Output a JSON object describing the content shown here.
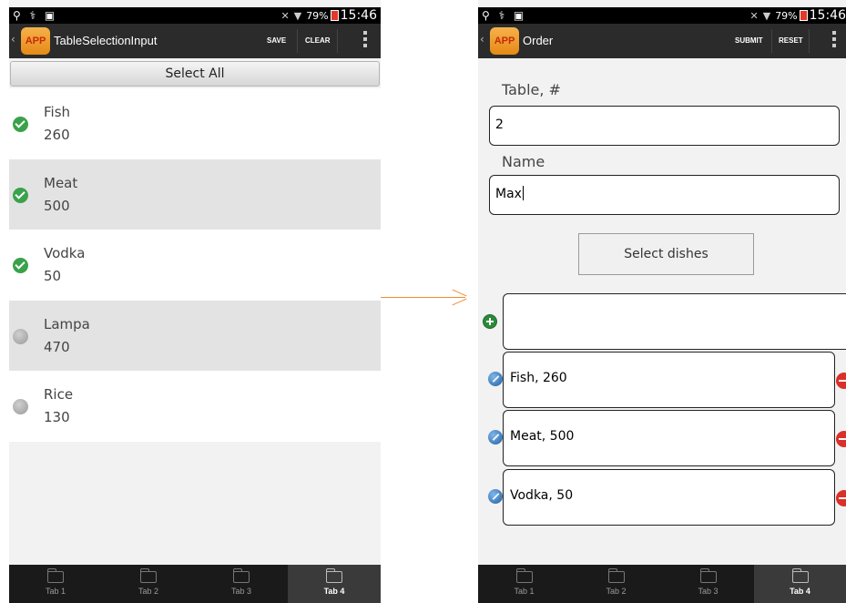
{
  "status_bar": {
    "battery": "79%",
    "time": "15:46"
  },
  "left_screen": {
    "logo_text": "APP",
    "title": "TableSelectionInput",
    "actions": {
      "save": "SAVE",
      "clear": "CLEAR"
    },
    "select_all_label": "Select All",
    "items": [
      {
        "name": "Fish",
        "value": "260",
        "selected": true
      },
      {
        "name": "Meat",
        "value": "500",
        "selected": true
      },
      {
        "name": "Vodka",
        "value": "50",
        "selected": true
      },
      {
        "name": "Lampa",
        "value": "470",
        "selected": false
      },
      {
        "name": "Rice",
        "value": "130",
        "selected": false
      }
    ]
  },
  "right_screen": {
    "logo_text": "APP",
    "title": "Order",
    "actions": {
      "submit": "SUBMIT",
      "reset": "RESET"
    },
    "table_label": "Table, #",
    "table_value": "2",
    "name_label": "Name",
    "name_value": "Max",
    "select_dishes_label": "Select dishes",
    "dishes": [
      "Fish, 260",
      "Meat, 500",
      "Vodka, 50"
    ]
  },
  "tabs": [
    {
      "label": "Tab 1",
      "active": false
    },
    {
      "label": "Tab 2",
      "active": false
    },
    {
      "label": "Tab 3",
      "active": false
    },
    {
      "label": "Tab 4",
      "active": true
    }
  ],
  "colors": {
    "accent_arrow": "#f08c30",
    "check_green": "#3aa24a",
    "remove_red": "#d9302a",
    "action_bar": "#2b2b2b"
  }
}
